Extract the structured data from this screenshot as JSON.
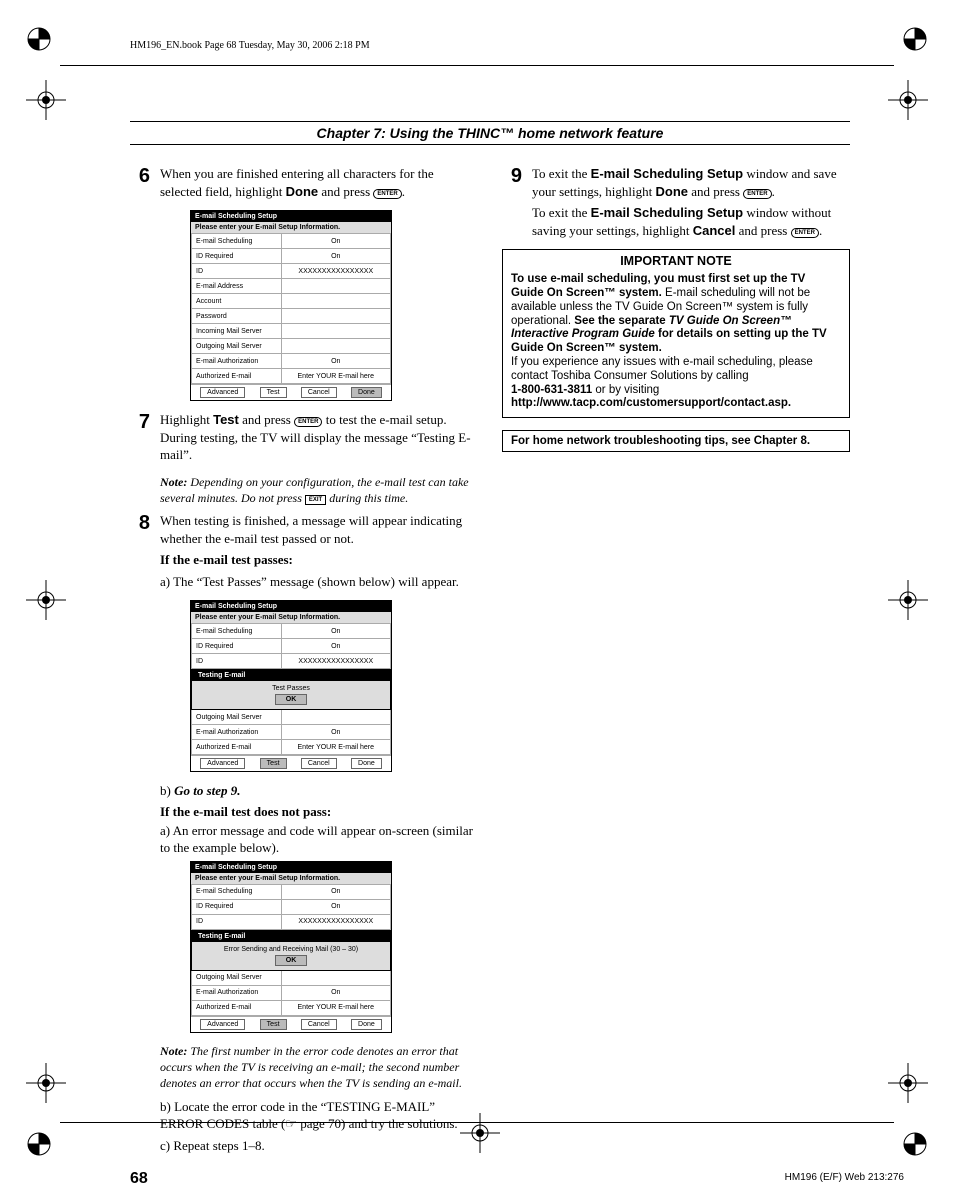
{
  "dochead": "HM196_EN.book  Page 68  Tuesday, May 30, 2006  2:18 PM",
  "chapter": "Chapter 7: Using the THINC™ home network feature",
  "enter_label": "ENTER",
  "exit_label": "EXIT",
  "left": {
    "s6a": "When you are finished entering all characters for the selected field, highlight ",
    "s6b": "Done",
    "s6c": " and press ",
    "s7a": "Highlight ",
    "s7b": "Test",
    "s7c": " and press ",
    "s7d": " to test the e-mail setup. During testing, the TV will display the message “Testing E-mail”.",
    "note1_lead": "Note:",
    "note1": " Depending on your configuration, the e-mail test can take several minutes. Do not press ",
    "note1_tail": " during this time.",
    "s8": "When testing is finished, a message will appear indicating whether the e-mail test passed or not.",
    "if_pass": "If the e-mail test passes:",
    "pass_a": "a) The “Test Passes” message (shown below) will appear.",
    "pass_b_lead": "b)",
    "pass_b": "Go to step 9.",
    "if_fail": "If the e-mail test does not pass:",
    "fail_a": "a) An error message and code will appear on-screen (similar to the example below).",
    "note2_lead": "Note:",
    "note2": " The first number in the error code denotes an error that occurs when the TV is receiving an e-mail; the second number denotes an error that occurs when the TV is sending an e-mail.",
    "fail_b": "b) Locate the error code in the “TESTING E-MAIL” ERROR CODES table (☞ page 70) and try the solutions.",
    "fail_c": "c) Repeat steps 1–8."
  },
  "right": {
    "s9a": "To exit the ",
    "s9b": "E-mail Scheduling Setup",
    "s9c": " window and save your settings, highlight ",
    "s9d": "Done",
    "s9e": " and press ",
    "s9f": "To exit the ",
    "s9g": "E-mail Scheduling Setup",
    "s9h": " window without saving your settings, highlight ",
    "s9i": "Cancel",
    "s9j": " and press ",
    "imp_head": "IMPORTANT NOTE",
    "imp1a": "To use e-mail scheduling, you must first set up the TV Guide On Screen™ system.",
    "imp1b": " E-mail scheduling will not be available unless the TV Guide On Screen™ system is fully operational. ",
    "imp1c": "See the separate ",
    "imp1d": "TV Guide On Screen™ Interactive Program Guide",
    "imp1e": " for details on setting up the TV Guide On Screen™ system.",
    "imp2": "If you experience any issues with e-mail scheduling, please contact Toshiba Consumer Solutions by calling",
    "imp3a": "1-800-631-3811",
    "imp3b": " or by visiting",
    "imp4": "http://www.tacp.com/customersupport/contact.asp.",
    "tips": "For home network troubleshooting tips, see Chapter 8."
  },
  "shot": {
    "title": "E-mail Scheduling Setup",
    "sub": "Please enter your E-mail Setup Information.",
    "rows": {
      "r0": "E-mail Scheduling",
      "v0": "On",
      "r1": "ID Required",
      "v1": "On",
      "r2": "ID",
      "v2": "XXXXXXXXXXXXXXXX",
      "r3": "E-mail Address",
      "v3": "",
      "r4": "Account",
      "v4": "",
      "r5": "Password",
      "v5": "",
      "r6": "Incoming Mail Server",
      "v6": "",
      "r7": "Outgoing Mail Server",
      "v7": "",
      "r8": "E-mail Authorization",
      "v8": "On",
      "r9": "Authorized E-mail",
      "v9": "Enter YOUR E-mail here"
    },
    "btns": {
      "adv": "Advanced",
      "test": "Test",
      "cancel": "Cancel",
      "done": "Done"
    },
    "testing_title": "Testing E-mail",
    "test_pass": "Test Passes",
    "test_err": "Error Sending and Receiving Mail (30 – 30)",
    "ok": "OK"
  },
  "pagenum": "68",
  "footer": "HM196 (E/F) Web 213:276"
}
